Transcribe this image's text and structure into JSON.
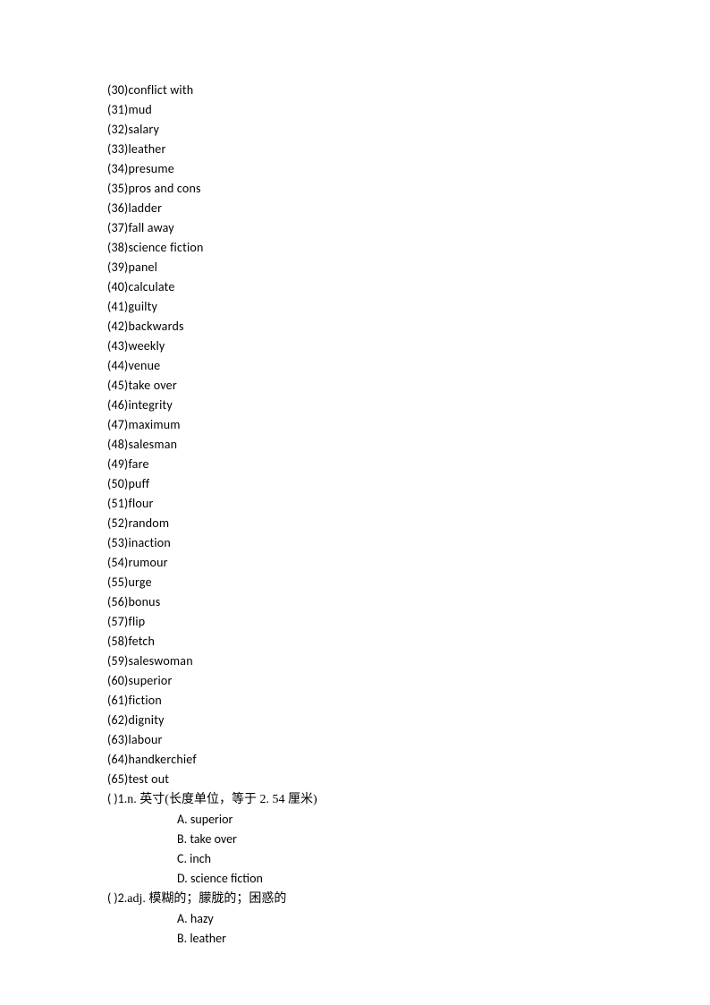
{
  "vocab": [
    {
      "num": "(30)",
      "word": "conflict with"
    },
    {
      "num": "(31)",
      "word": "mud"
    },
    {
      "num": "(32)",
      "word": "salary"
    },
    {
      "num": "(33)",
      "word": "leather"
    },
    {
      "num": "(34)",
      "word": "presume"
    },
    {
      "num": "(35)",
      "word": "pros and cons"
    },
    {
      "num": "(36)",
      "word": "ladder"
    },
    {
      "num": "(37)",
      "word": "fall away"
    },
    {
      "num": "(38)",
      "word": "science fiction"
    },
    {
      "num": "(39)",
      "word": "panel"
    },
    {
      "num": "(40)",
      "word": "calculate"
    },
    {
      "num": "(41)",
      "word": "guilty"
    },
    {
      "num": "(42)",
      "word": "backwards"
    },
    {
      "num": "(43)",
      "word": "weekly"
    },
    {
      "num": "(44)",
      "word": "venue"
    },
    {
      "num": "(45)",
      "word": "take over"
    },
    {
      "num": "(46)",
      "word": "integrity"
    },
    {
      "num": "(47)",
      "word": "maximum"
    },
    {
      "num": "(48)",
      "word": "salesman"
    },
    {
      "num": "(49)",
      "word": "fare"
    },
    {
      "num": "(50)",
      "word": "puff"
    },
    {
      "num": "(51)",
      "word": "flour"
    },
    {
      "num": "(52)",
      "word": "random"
    },
    {
      "num": "(53)",
      "word": "inaction"
    },
    {
      "num": "(54)",
      "word": "rumour"
    },
    {
      "num": "(55)",
      "word": "urge"
    },
    {
      "num": "(56)",
      "word": "bonus"
    },
    {
      "num": "(57)",
      "word": "flip"
    },
    {
      "num": "(58)",
      "word": "fetch"
    },
    {
      "num": "(59)",
      "word": "saleswoman"
    },
    {
      "num": "(60)",
      "word": "superior"
    },
    {
      "num": "(61)",
      "word": "fiction"
    },
    {
      "num": "(62)",
      "word": "dignity"
    },
    {
      "num": "(63)",
      "word": "labour"
    },
    {
      "num": "(64)",
      "word": "handkerchief"
    },
    {
      "num": "(65)",
      "word": "test out"
    }
  ],
  "questions": [
    {
      "paren": "(          )",
      "num": "1.",
      "prompt": "n. 英寸(长度单位，等于 2. 54 厘米)",
      "options": [
        "A. superior",
        "B. take over",
        "C. inch",
        "D. science fiction"
      ]
    },
    {
      "paren": "(          )",
      "num": "2.",
      "prompt": "adj. 模糊的；朦胧的；困惑的",
      "options": [
        "A. hazy",
        "B. leather"
      ]
    }
  ]
}
